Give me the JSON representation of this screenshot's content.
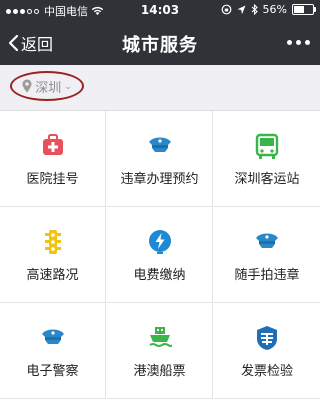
{
  "status_bar": {
    "carrier": "中国电信",
    "time": "14:03",
    "battery_percent": "56%",
    "battery_level": 0.56
  },
  "nav": {
    "back_label": "返回",
    "title": "城市服务"
  },
  "location": {
    "city": "深圳",
    "highlight_color": "#9a2222"
  },
  "services": [
    {
      "label": "医院挂号",
      "icon": "hospital-kit-icon",
      "color": "#e8505b"
    },
    {
      "label": "违章办理预约",
      "icon": "police-cap-icon",
      "color": "#2a88c8"
    },
    {
      "label": "深圳客运站",
      "icon": "bus-icon",
      "color": "#3ab54a"
    },
    {
      "label": "高速路况",
      "icon": "traffic-light-icon",
      "color": "#f1c40f"
    },
    {
      "label": "电费缴纳",
      "icon": "lightning-icon",
      "color": "#1e8ad3"
    },
    {
      "label": "随手拍违章",
      "icon": "police-cap-icon",
      "color": "#2a88c8"
    },
    {
      "label": "电子警察",
      "icon": "police-cap-icon",
      "color": "#2a88c8"
    },
    {
      "label": "港澳船票",
      "icon": "ship-icon",
      "color": "#3ab54a"
    },
    {
      "label": "发票检验",
      "icon": "tax-emblem-icon",
      "color": "#1e6fb8"
    }
  ]
}
